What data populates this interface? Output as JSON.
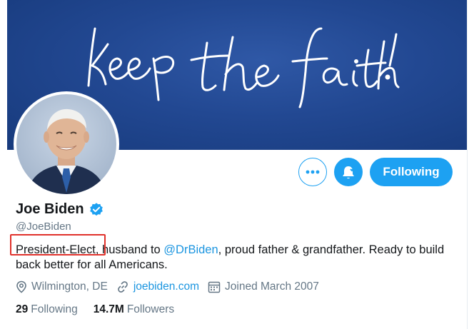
{
  "banner": {
    "script_text": "keep the faith!",
    "color": "#224892"
  },
  "actions": {
    "more_icon": "ellipsis-icon",
    "notify_icon": "bell-icon",
    "follow_label": "Following"
  },
  "profile": {
    "name": "Joe Biden",
    "handle": "@JoeBiden",
    "bio_highlight": "President-Elect,",
    "bio_text_1": " husband to ",
    "bio_mention": "@DrBiden",
    "bio_text_2": ", proud father & grandfather. Ready to build back better for all Americans.",
    "location": "Wilmington, DE",
    "website": "joebiden.com",
    "joined": "Joined March 2007"
  },
  "stats": {
    "following_count": "29",
    "following_label": "Following",
    "followers_count": "14.7M",
    "followers_label": "Followers"
  },
  "colors": {
    "accent": "#1da1f2",
    "highlight_border": "#e0312b"
  }
}
